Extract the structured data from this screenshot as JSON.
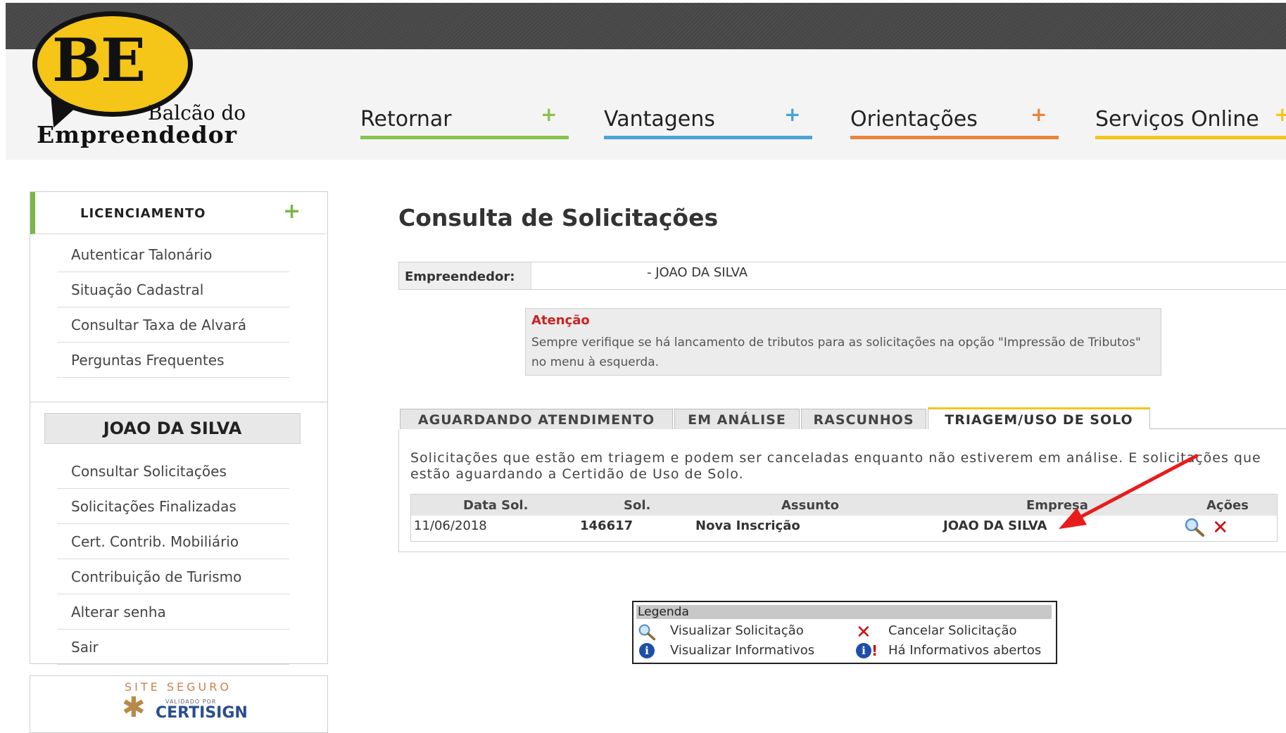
{
  "header": {
    "logo_mark": "BE",
    "logo_line1": "Balcão do",
    "logo_line2": "Empreendedor",
    "nav": [
      {
        "label": "Retornar",
        "color": "#8bc34a"
      },
      {
        "label": "Vantagens",
        "color": "#4aa3d8"
      },
      {
        "label": "Orientações",
        "color": "#e8843c"
      },
      {
        "label": "Serviços Online",
        "color": "#f5c518"
      }
    ],
    "plus": "+"
  },
  "sidebar": {
    "section_title": "LICENCIAMENTO",
    "section_plus": "+",
    "items": [
      "Autenticar Talonário",
      "Situação Cadastral",
      "Consultar Taxa de Alvará",
      "Perguntas Frequentes"
    ],
    "user_name": "JOAO DA SILVA",
    "user_items": [
      "Consultar Solicitações",
      "Solicitações Finalizadas",
      "Cert. Contrib. Mobiliário",
      "Contribuição de Turismo",
      "Alterar senha",
      "Sair"
    ],
    "secure_line1": "SITE SEGURO",
    "secure_line2": "VALIDADO POR",
    "secure_line3": "CERTISIGN"
  },
  "main": {
    "title": "Consulta de Solicitações",
    "empreendedor_label": "Empreendedor:",
    "empreendedor_value": "- JOAO DA SILVA",
    "attention_title": "Atenção",
    "attention_text": "Sempre verifique se há lancamento de tributos para as solicitações na opção \"Impressão de Tributos\" no menu à esquerda.",
    "tabs": [
      "AGUARDANDO ATENDIMENTO",
      "EM ANÁLISE",
      "RASCUNHOS",
      "TRIAGEM/USO DE SOLO"
    ],
    "active_tab": 3,
    "panel_description": "Solicitações que estão em triagem e podem ser canceladas enquanto não estiverem em análise. E solicitações que estão aguardando a Certidão de Uso de Solo.",
    "columns": [
      "Data Sol.",
      "Sol.",
      "Assunto",
      "Empresa",
      "Ações"
    ],
    "rows": [
      {
        "data": "11/06/2018",
        "sol": "146617",
        "assunto": "Nova Inscrição",
        "empresa": "JOAO DA SILVA"
      }
    ]
  },
  "legend": {
    "title": "Legenda",
    "view_request": "Visualizar Solicitação",
    "cancel_request": "Cancelar Solicitação",
    "view_info": "Visualizar Informativos",
    "open_info": "Há Informativos abertos"
  },
  "annotation_color": "#e81c1c"
}
